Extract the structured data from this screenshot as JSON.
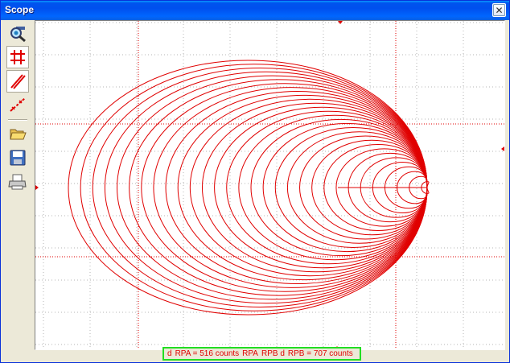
{
  "window": {
    "title": "Scope",
    "close_glyph": "✕"
  },
  "toolbar": {
    "items": [
      {
        "name": "zoom-icon",
        "pressed": false
      },
      {
        "name": "grid-icon",
        "pressed": true
      },
      {
        "name": "line-icon",
        "pressed": true
      },
      {
        "name": "points-icon",
        "pressed": false
      },
      {
        "name": "open-folder-icon",
        "pressed": false
      },
      {
        "name": "save-icon",
        "pressed": false
      },
      {
        "name": "print-icon",
        "pressed": false
      }
    ]
  },
  "status": {
    "parts": [
      "d",
      "RPA = 516 counts",
      "RPA",
      "RPB d",
      "RPB = 707 counts"
    ]
  },
  "colors": {
    "trace": "#e00000",
    "grid": "#b4b4b4",
    "cursor": "#e00000",
    "status_border": "#22dd22"
  }
}
